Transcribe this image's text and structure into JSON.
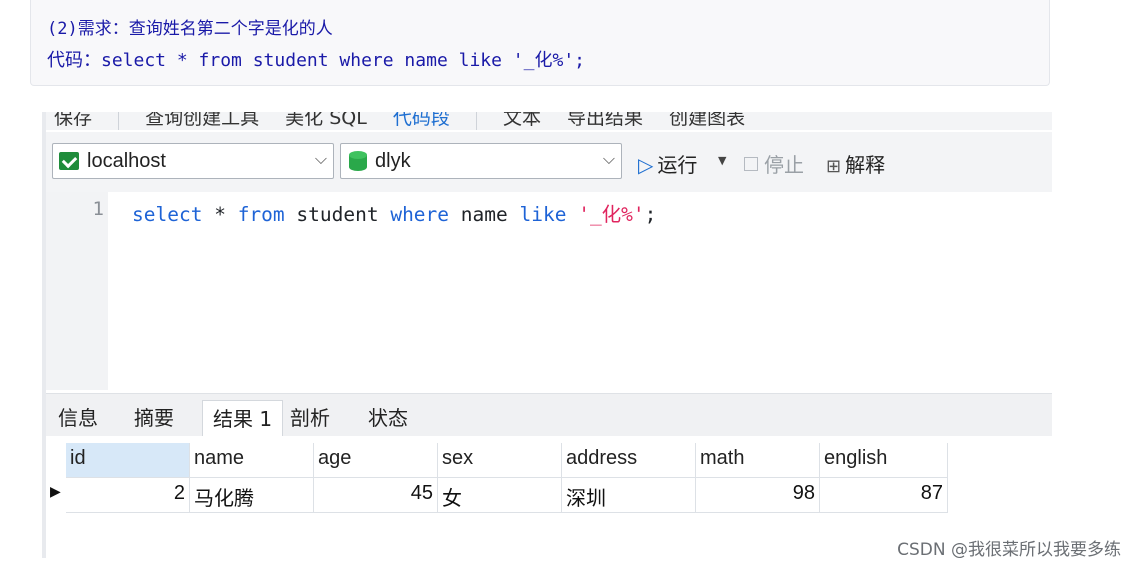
{
  "note": {
    "line1": "(2)需求：查询姓名第二个字是化的人",
    "line2": "代码：select * from student where name like '_化%';"
  },
  "toolbar": {
    "items": [
      "保存",
      "查询创建工具",
      "美化 SQL",
      "代码段",
      "文本",
      "导出结果",
      "创建图表"
    ]
  },
  "connection": {
    "value": "localhost"
  },
  "database": {
    "value": "dlyk"
  },
  "actions": {
    "run": "运行",
    "stop": "停止",
    "explain": "解释"
  },
  "editor": {
    "line_number": "1",
    "tokens": {
      "select": "select",
      "star": " * ",
      "from": "from",
      "table": " student ",
      "where": "where",
      "name": " name ",
      "like": "like",
      "space": " ",
      "pattern": "'_化%'",
      "semicolon": ";"
    }
  },
  "result_tabs": [
    "信息",
    "摘要",
    "结果 1",
    "剖析",
    "状态"
  ],
  "active_tab": "结果 1",
  "table": {
    "columns": [
      "id",
      "name",
      "age",
      "sex",
      "address",
      "math",
      "english"
    ],
    "rows": [
      [
        "2",
        "马化腾",
        "45",
        "女",
        "深圳",
        "98",
        "87"
      ]
    ]
  },
  "colors": {
    "keyword": "#1e63d6",
    "string": "#e0245e",
    "note_text": "#1a1aa8"
  },
  "watermark": "CSDN @我很菜所以我要多练"
}
